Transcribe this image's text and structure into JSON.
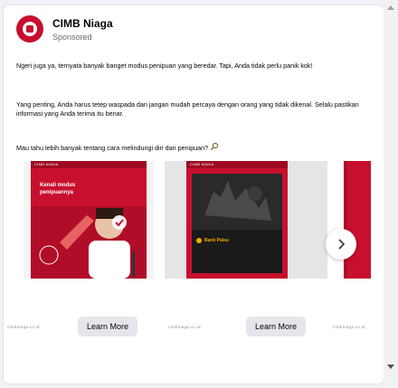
{
  "post": {
    "page_name": "CIMB Niaga",
    "sponsored": "Sponsored",
    "paragraphs": [
      "Ngeri juga ya, ternyata banyak banget modus penipuan yang beredar. Tapi, Anda tidak perlu panik kok!",
      "Yang penting, Anda harus tetep waspada dan jangan mudah percaya dengan orang yang tidak dikenal. Selalu pastikan informasi yang Anda terima itu benar.",
      "Mau tahu lebih banyak tentang cara melindungi diri dari penipuan?"
    ]
  },
  "carousel": {
    "slide1": {
      "brand": "CIMB NIAGA",
      "headline_line1": "Kenali modus",
      "headline_line2": "penipuannya"
    },
    "slide2": {
      "brand": "CIMB NIAGA",
      "badge": "Bank Palsu"
    },
    "next_icon": "chevron-right-icon"
  },
  "cta": {
    "brand_small": "cimbniaga.co.id",
    "learn_more": "Learn More"
  },
  "colors": {
    "brand_red": "#c8102e",
    "button_gray": "#e4e6eb",
    "text_dark": "#050505",
    "text_muted": "#65676b"
  }
}
